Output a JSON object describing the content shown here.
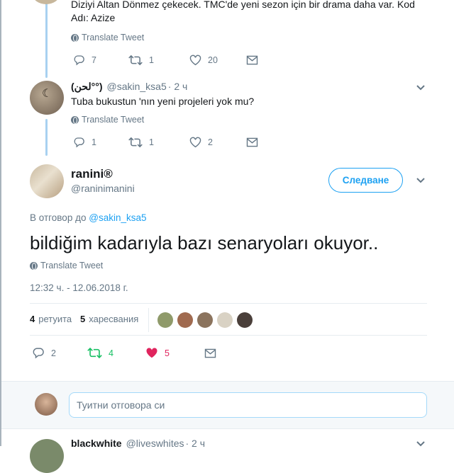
{
  "top_tweet": {
    "text": "Diziyi Altan Dönmez çekecek. TMC'de yeni sezon için bir drama daha var. Kod Adı: Azize",
    "translate": "Translate Tweet",
    "replies": "7",
    "retweets": "1",
    "likes": "20"
  },
  "reply_tweet": {
    "display_name": "(لحن°°)",
    "handle": "@sakin_ksa5",
    "time": "· 2 ч",
    "text": "Tuba bukustun 'nın yeni projeleri yok mu?",
    "translate": "Translate Tweet",
    "replies": "1",
    "retweets": "1",
    "likes": "2"
  },
  "main_tweet": {
    "display_name": "ranini®",
    "handle": "@raninimanini",
    "follow_label": "Следване",
    "in_reply_prefix": "В отговор до",
    "in_reply_handle": "@sakin_ksa5",
    "text": "bildiğim kadarıyla bazı senaryoları okuyor..",
    "translate": "Translate Tweet",
    "timestamp": "12:32 ч. - 12.06.2018 г.",
    "retweet_count": "4",
    "retweet_label": "ретуита",
    "like_count": "5",
    "like_label": "харесвания",
    "replies": "2",
    "retweets": "4",
    "likes": "5"
  },
  "reply_box": {
    "placeholder": "Туитни отговора си"
  },
  "next_tweet": {
    "display_name": "blackwhite",
    "handle": "@liveswhites",
    "time": "· 2 ч"
  },
  "colors": {
    "accent": "#1da1f2",
    "retweet_green": "#17bf63",
    "like_red": "#e0245e",
    "muted": "#657786"
  }
}
